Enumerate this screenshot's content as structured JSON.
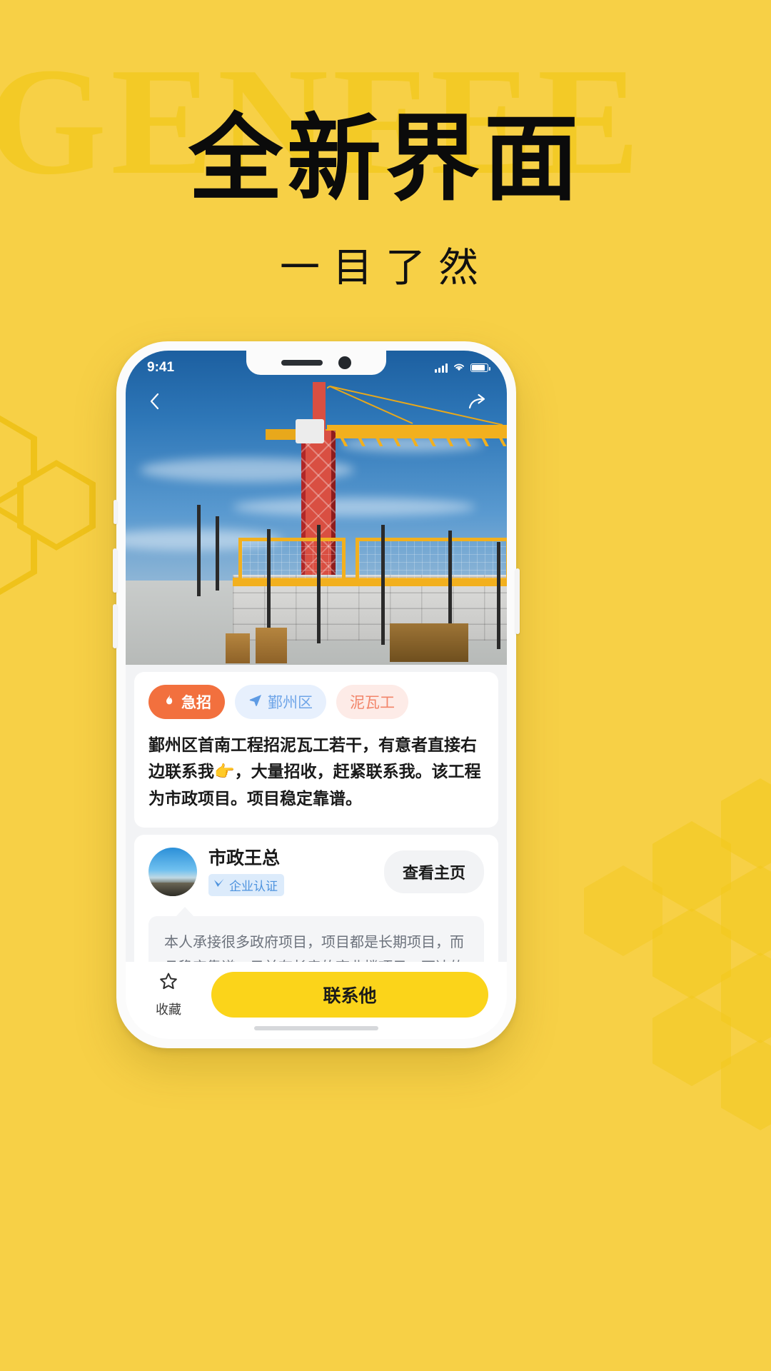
{
  "poster": {
    "background_color": "#F7D046",
    "watermark_text": "GENFEE",
    "headline": "全新界面",
    "subhead": "一目了然"
  },
  "phone": {
    "status_bar": {
      "time": "9:41",
      "signal_icon": "cellular-bars-icon",
      "wifi_icon": "wifi-icon",
      "battery_icon": "battery-icon"
    },
    "nav": {
      "back_icon": "chevron-left-icon",
      "share_icon": "share-arrow-icon"
    },
    "hero": {
      "alt": "construction-site-tower-crane-photo"
    },
    "post": {
      "tags": [
        {
          "icon": "fire-icon",
          "label": "急招",
          "style": "urgent",
          "color": "#F2703E"
        },
        {
          "icon": "location-arrow-icon",
          "label": "鄞州区",
          "style": "area",
          "color": "#6FA5E8"
        },
        {
          "icon": "",
          "label": "泥瓦工",
          "style": "job",
          "color": "#F2856A"
        }
      ],
      "description": "鄞州区首南工程招泥瓦工若干，有意者直接右边联系我👉，大量招收，赶紧联系我。该工程为市政项目。项目稳定靠谱。"
    },
    "profile": {
      "avatar_icon": "user-avatar",
      "name": "市政王总",
      "verify_icon": "verified-check-icon",
      "verify_label": "企业认证",
      "homepage_button": "查看主页",
      "bubble_text": "本人承接很多政府项目，项目都是长期项目，而且稳定靠谱，目前有长房的商业楼项目，万达的民主楼的项目，大量缺泥瓦工，电工，油漆工，木工，这方面的好手直接联系我，价格美丽。"
    },
    "bottom_bar": {
      "favorite_icon": "star-outline-icon",
      "favorite_label": "收藏",
      "contact_label": "联系他",
      "contact_color": "#FBD41A"
    }
  }
}
